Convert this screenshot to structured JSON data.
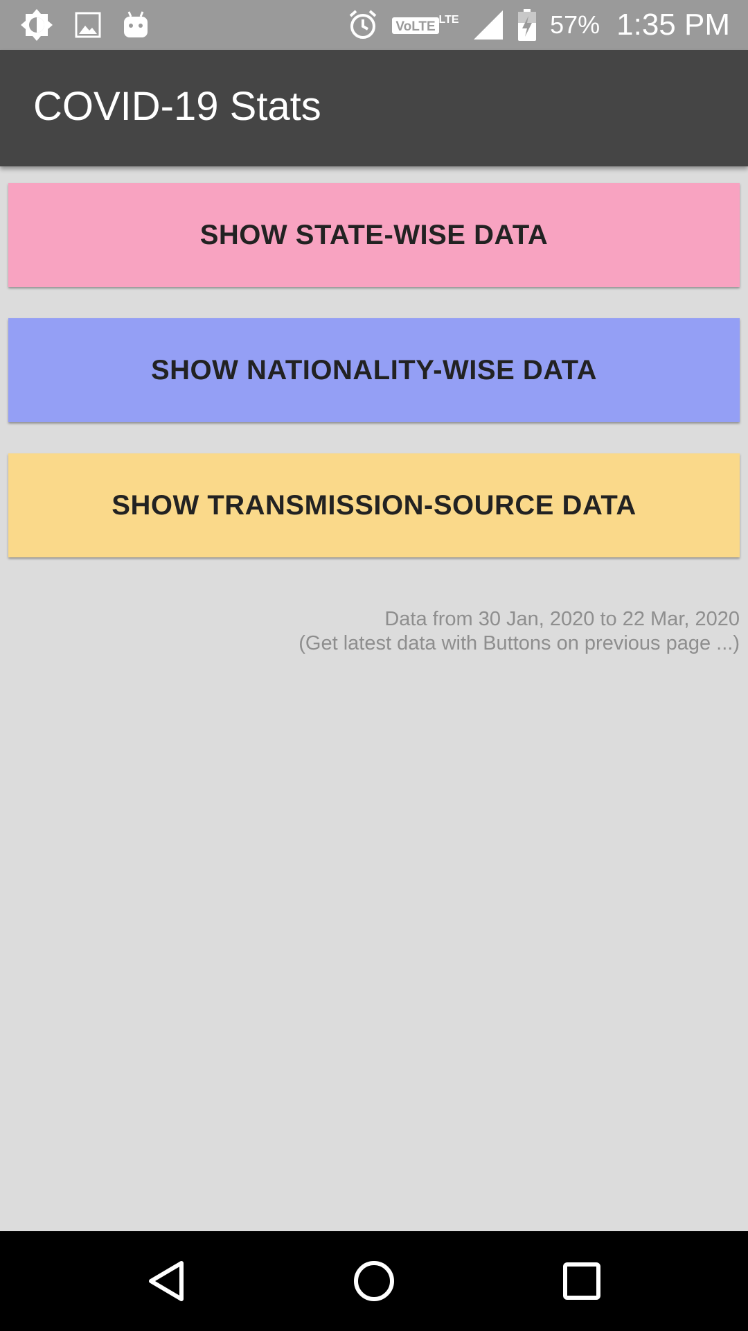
{
  "status_bar": {
    "battery_text": "57%",
    "time": "1:35 PM",
    "network_label": "VoLTE",
    "network_type": "LTE",
    "icons_left": [
      "brightness-icon",
      "image-icon",
      "android-icon"
    ],
    "icons_right": [
      "alarm-icon",
      "volte-icon",
      "signal-icon",
      "battery-charging-icon"
    ]
  },
  "app_bar": {
    "title": "COVID-19 Stats",
    "background": "#454545"
  },
  "buttons": [
    {
      "label": "SHOW STATE-WISE DATA",
      "color": "#f8a3c1"
    },
    {
      "label": "SHOW NATIONALITY-WISE DATA",
      "color": "#949ff5"
    },
    {
      "label": "SHOW TRANSMISSION-SOURCE DATA",
      "color": "#fad98a"
    }
  ],
  "note": {
    "line1": "Data from 30 Jan, 2020 to 22 Mar, 2020",
    "line2": "(Get latest data with Buttons on previous page ...)"
  },
  "nav_bar": {
    "icons": [
      "back-icon",
      "home-icon",
      "recents-icon"
    ]
  }
}
